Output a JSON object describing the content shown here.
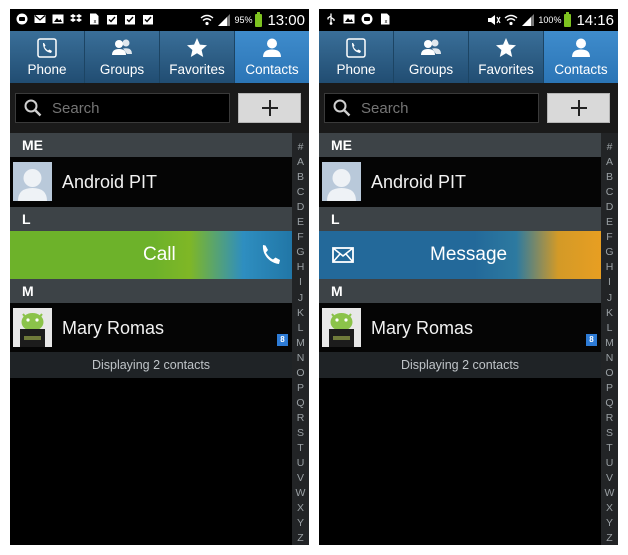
{
  "left": {
    "status": {
      "battery": "95%",
      "time": "13:00"
    },
    "tabs": [
      "Phone",
      "Groups",
      "Favorites",
      "Contacts"
    ],
    "search_placeholder": "Search",
    "sections": {
      "me": "ME",
      "l": "L",
      "m": "M"
    },
    "contacts": {
      "me": "Android PIT",
      "m": "Mary Romas"
    },
    "swipe_label": "Call",
    "footer": "Displaying 2 contacts"
  },
  "right": {
    "status": {
      "battery": "100%",
      "time": "14:16"
    },
    "tabs": [
      "Phone",
      "Groups",
      "Favorites",
      "Contacts"
    ],
    "search_placeholder": "Search",
    "sections": {
      "me": "ME",
      "l": "L",
      "m": "M"
    },
    "contacts": {
      "me": "Android PIT",
      "m": "Mary Romas"
    },
    "swipe_label": "Message",
    "footer": "Displaying 2 contacts"
  },
  "index_letters": [
    "#",
    "A",
    "B",
    "C",
    "D",
    "E",
    "F",
    "G",
    "H",
    "I",
    "J",
    "K",
    "L",
    "M",
    "N",
    "O",
    "P",
    "Q",
    "R",
    "S",
    "T",
    "U",
    "V",
    "W",
    "X",
    "Y",
    "Z"
  ],
  "badge_text": "8",
  "colors": {
    "tab_active": "#2b75b6",
    "call_green": "#6db22a",
    "message_blue": "#23699a",
    "message_orange": "#f0a020"
  }
}
